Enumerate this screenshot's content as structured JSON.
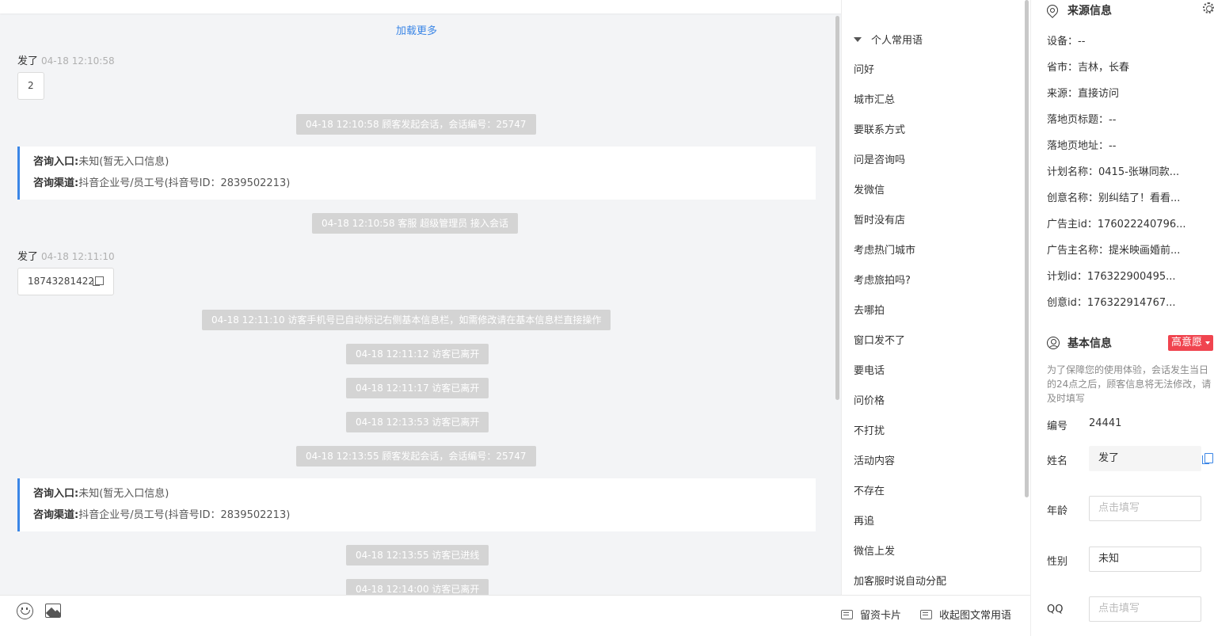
{
  "chat": {
    "load_more": "加载更多",
    "messages": [
      {
        "sender": "发了",
        "time": "04-18 12:10:58",
        "content": "2"
      },
      {
        "sender": "发了",
        "time": "04-18 12:11:10",
        "content": "18743281422"
      }
    ],
    "system_msgs": [
      "04-18 12:10:58 顾客发起会话，会话编号：25747",
      "04-18 12:10:58 客服 超级管理员 接入会话",
      "04-18 12:11:10 访客手机号已自动标记右侧基本信息栏，如需修改请在基本信息栏直接操作",
      "04-18 12:11:12 访客已离开",
      "04-18 12:11:17 访客已离开",
      "04-18 12:13:53 访客已离开",
      "04-18 12:13:55 顾客发起会话，会话编号：25747",
      "04-18 12:13:55 访客已进线",
      "04-18 12:14:00 访客已离开"
    ],
    "info_cards": [
      {
        "entry_label": "咨询入口:",
        "entry_value": "未知(暂无入口信息)",
        "channel_label": "咨询渠道:",
        "channel_value": "抖音企业号/员工号(抖音号ID：2839502213)"
      },
      {
        "entry_label": "咨询入口:",
        "entry_value": "未知(暂无入口信息)",
        "channel_label": "咨询渠道:",
        "channel_value": "抖音企业号/员工号(抖音号ID：2839502213)"
      }
    ]
  },
  "toolbar": {
    "card_btn": "留资卡片",
    "collapse_btn": "收起图文常用语"
  },
  "phrases": {
    "group_title": "个人常用语",
    "items": [
      "问好",
      "城市汇总",
      "要联系方式",
      "问是咨询吗",
      "发微信",
      "暂时没有店",
      "考虑热门城市",
      "考虑旅拍吗?",
      "去哪拍",
      "窗口发不了",
      "要电话",
      "问价格",
      "不打扰",
      "活动内容",
      "不存在",
      "再追",
      "微信上发",
      "加客服时说自动分配"
    ]
  },
  "source_info": {
    "title": "来源信息",
    "rows": [
      "设备：--",
      "省市：吉林，长春",
      "来源：直接访问",
      "落地页标题：--",
      "落地页地址：--",
      "计划名称：0415-张琳同款...",
      "创意名称：别纠结了！看看...",
      "广告主id：176022240796...",
      "广告主名称：提米映画婚前...",
      "计划id：176322900495...",
      "创意id：176322914767..."
    ]
  },
  "basic_info": {
    "title": "基本信息",
    "badge": "高意愿",
    "note": "为了保障您的使用体验，会话发生当日的24点之后，顾客信息将无法修改，请及时填写",
    "id_label": "编号",
    "id_value": "24441",
    "name_label": "姓名",
    "name_value": "发了",
    "age_label": "年龄",
    "age_placeholder": "点击填写",
    "gender_label": "性别",
    "gender_value": "未知",
    "qq_label": "QQ",
    "qq_placeholder": "点击填写"
  }
}
